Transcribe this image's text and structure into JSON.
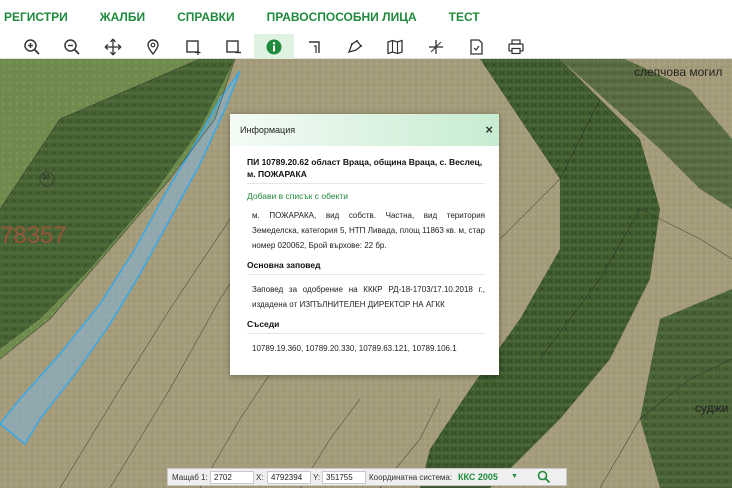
{
  "menu": {
    "items": [
      "РЕГИСТРИ",
      "ЖАЛБИ",
      "СПРАВКИ",
      "ПРАВОСПОСОБНИ ЛИЦА",
      "ТЕСТ"
    ]
  },
  "toolbar": {
    "tools": [
      "zoom-in-icon",
      "zoom-out-icon",
      "pan-icon",
      "location-pin-icon",
      "select-rectangle-icon",
      "select-rectangle-minus-icon",
      "info-icon",
      "measure-line-icon",
      "measure-area-icon",
      "map-layers-icon",
      "coordinates-icon",
      "report-icon",
      "print-icon"
    ],
    "active_tool": "info-icon",
    "accent": "#1f8a3c"
  },
  "map": {
    "labels": {
      "place1": "слепчова могил",
      "place2": "суджи",
      "parcel_big": "78357",
      "parcel_small": "10"
    }
  },
  "dialog": {
    "header": "Информация",
    "close": "×",
    "title": "ПИ 10789.20.62 област Враца, община Враца, с. Веслец, м. ПОЖАРАКА",
    "add_link": "Добави в списък с обекти",
    "description": "м. ПОЖАРАКА, вид собств. Частна, вид територия Земеделска, категория 5, НТП Ливада, площ 11863 кв. м, стар номер 020062, Брой върхове: 22 бр.",
    "order_heading": "Основна заповед",
    "order_text": "Заповед за одобрение на КККР РД-18-1703/17.10.2018 г., издадена от ИЗПЪЛНИТЕЛЕН ДИРЕКТОР НА АГКК",
    "neighbors_heading": "Съседи",
    "neighbors": "10789.19.360, 10789.20.330, 10789.63.121, 10789.106.1"
  },
  "status": {
    "scale_label": "Мащаб 1:",
    "scale_value": "2702",
    "x_label": "X:",
    "x_value": "4792394",
    "y_label": "Y:",
    "y_value": "351755",
    "system_label": "Координатна система:",
    "system_value": "ККС 2005",
    "dropdown_arrow": "▼"
  }
}
